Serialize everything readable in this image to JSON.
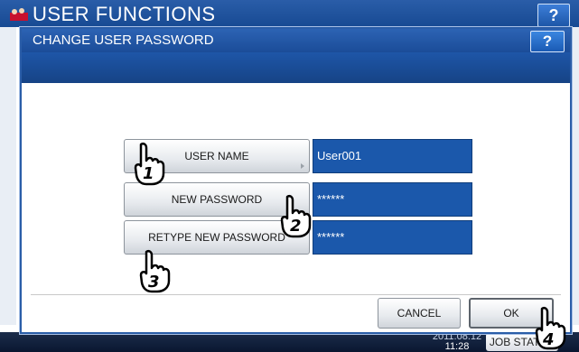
{
  "background": {
    "title": "USER FUNCTIONS",
    "help_label": "?",
    "clock_date": "2011.08.12",
    "clock_time": "11:28",
    "job_status_label": "JOB STATUS"
  },
  "dialog": {
    "title": "CHANGE USER PASSWORD",
    "help_label": "?",
    "rows": [
      {
        "button_label": "USER NAME",
        "value": "User001"
      },
      {
        "button_label": "NEW PASSWORD",
        "value": "******"
      },
      {
        "button_label": "RETYPE NEW PASSWORD",
        "value": "******"
      }
    ],
    "cancel_label": "CANCEL",
    "ok_label": "OK"
  },
  "callouts": [
    "1",
    "2",
    "3",
    "4"
  ],
  "colors": {
    "title_bar": "#1b4c98",
    "field_bg": "#1b58ab",
    "button_face": "#e7eaee"
  }
}
